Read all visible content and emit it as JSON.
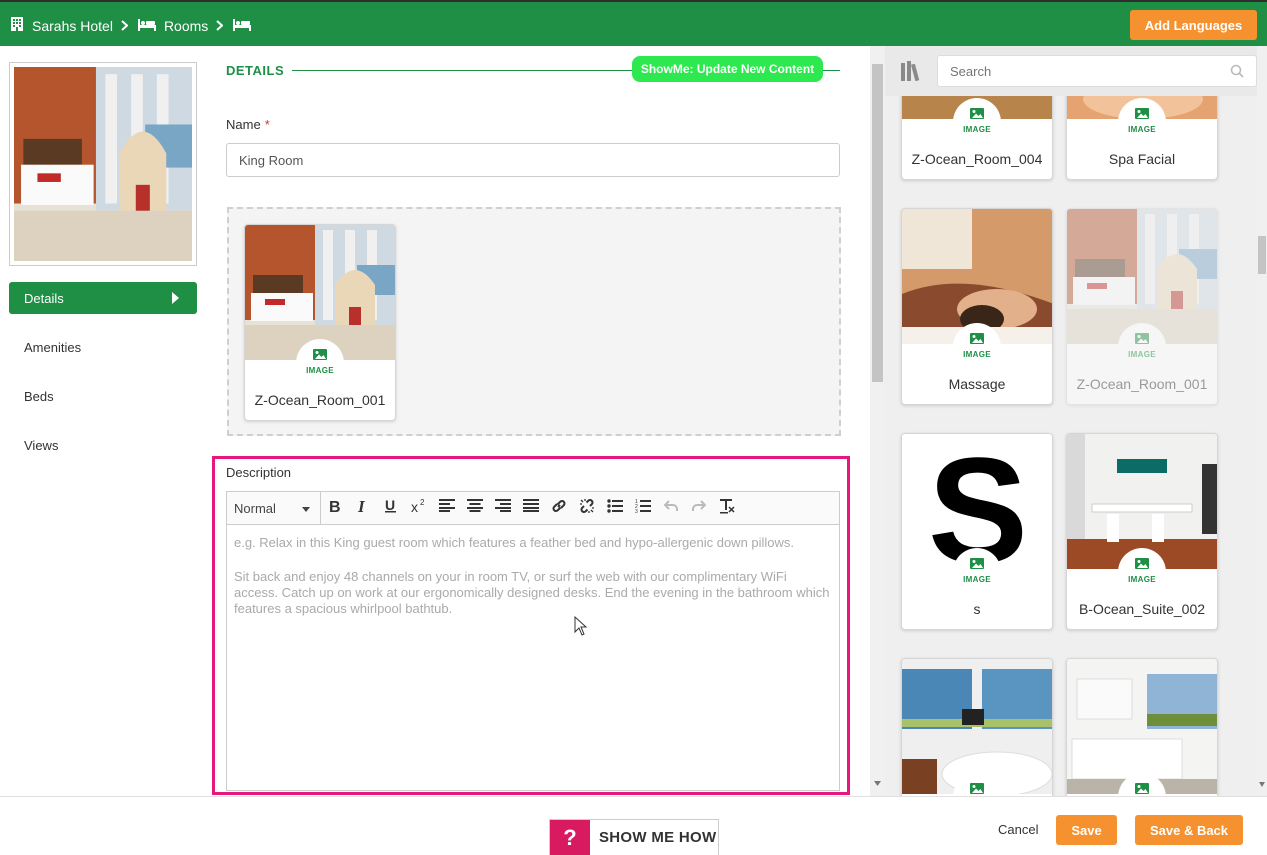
{
  "breadcrumb": {
    "hotel": "Sarahs Hotel",
    "rooms": "Rooms"
  },
  "header": {
    "add_languages": "Add Languages"
  },
  "sidebar": {
    "items": [
      {
        "label": "Details",
        "active": true
      },
      {
        "label": "Amenities"
      },
      {
        "label": "Beds"
      },
      {
        "label": "Views"
      }
    ]
  },
  "details": {
    "section_title": "DETAILS",
    "showme_label": "ShowMe: Update New Content",
    "name_label": "Name",
    "name_required": "*",
    "name_value": "King Room",
    "selected_image": {
      "title": "Z-Ocean_Room_001",
      "badge": "IMAGE"
    }
  },
  "description": {
    "label": "Description",
    "format_select": "Normal",
    "placeholder_line1": "e.g. Relax in this King guest room which features a feather bed and hypo-allergenic down pillows.",
    "placeholder_line2": "Sit back and enjoy 48 channels on your in room TV, or surf the web with our complimentary WiFi access. Catch up on work at our ergonomically designed desks. End the evening in the bathroom which features a spacious whirlpool bathtub.",
    "toolbar_icons": [
      "bold-icon",
      "italic-icon",
      "underline-icon",
      "superscript-icon",
      "align-left-icon",
      "align-center-icon",
      "align-right-icon",
      "align-justify-icon",
      "link-icon",
      "unlink-icon",
      "bullet-list-icon",
      "numbered-list-icon",
      "undo-icon",
      "redo-icon",
      "clear-format-icon"
    ]
  },
  "library": {
    "search_placeholder": "Search",
    "badge": "IMAGE",
    "cards": [
      {
        "title": "Z-Ocean_Room_004"
      },
      {
        "title": "Spa Facial"
      },
      {
        "title": "Massage"
      },
      {
        "title": "Z-Ocean_Room_001",
        "dimmed": true
      },
      {
        "title": "s"
      },
      {
        "title": "B-Ocean_Suite_002"
      },
      {
        "title": ""
      },
      {
        "title": ""
      }
    ]
  },
  "footer": {
    "show_me_how": "SHOW ME HOW",
    "help_glyph": "?",
    "cancel": "Cancel",
    "save": "Save",
    "save_back": "Save & Back"
  },
  "colors": {
    "brand_green": "#1e8f45",
    "accent_orange": "#f5922f",
    "highlight_pink": "#e8177e",
    "showme_green": "#2de84e"
  }
}
